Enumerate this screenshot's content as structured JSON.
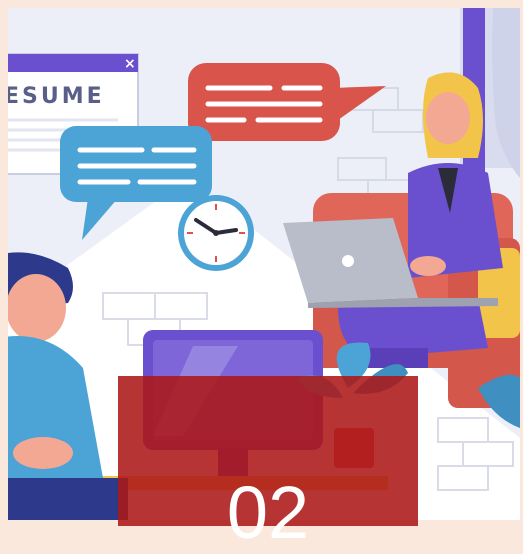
{
  "illustration": {
    "resume_window": {
      "title_text": "ESUME",
      "close_glyph": "×"
    }
  },
  "overlay": {
    "number_text": "02"
  },
  "colors": {
    "background": "#fbe8dd",
    "overlay": "#ac1818",
    "speech_red": "#d9554b",
    "speech_blue": "#4ba3d6",
    "purple": "#6a4fcf",
    "couch": "#e0665a"
  }
}
